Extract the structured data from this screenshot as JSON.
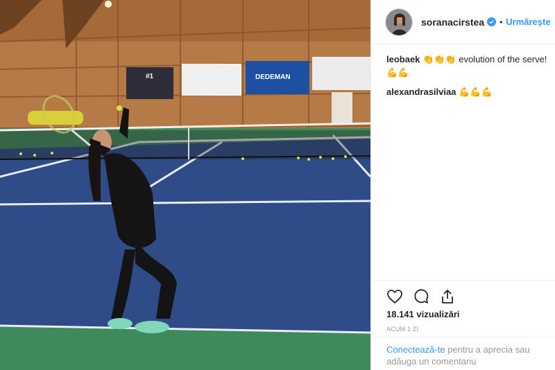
{
  "post": {
    "username": "soranacirstea",
    "follow_label": "Urmărește",
    "separator": "•",
    "icons": {
      "verified": "verified-badge-icon",
      "like": "heart-icon",
      "comment": "comment-bubble-icon",
      "share": "share-icon"
    },
    "colors": {
      "accent": "#3897f0",
      "text": "#262626",
      "muted": "#999999",
      "court_blue": "#2f4c89",
      "court_green": "#3f8a5c"
    }
  },
  "comments": [
    {
      "author": "leobaek",
      "text": "👏👏👏 evolution of the serve!",
      "text_line2": "💪💪"
    },
    {
      "author": "alexandrasilviaa",
      "text": "💪💪💪",
      "text_line2": ""
    }
  ],
  "stats": {
    "views": "18.141 vizualizări",
    "timestamp": "ACUM 1 ZI"
  },
  "login_prompt": {
    "link_text": "Conectează-te",
    "rest_text": " pentru a aprecia sau adăuga un comentariu"
  },
  "media": {
    "banners": [
      {
        "text": "DEDEMAN"
      },
      {
        "text": "#1"
      }
    ]
  }
}
